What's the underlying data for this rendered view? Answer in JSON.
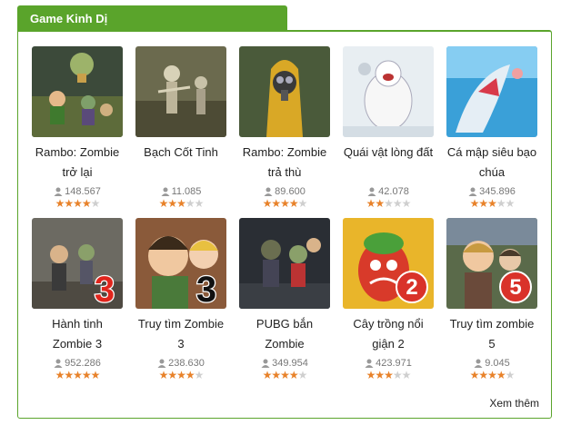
{
  "section": {
    "title": "Game Kinh Dị",
    "more_label": "Xem thêm"
  },
  "colors": {
    "accent": "#5aa42b",
    "star_on": "#e8822a",
    "star_off": "#cfcfcf"
  },
  "games": [
    {
      "title_l1": "Rambo: Zombie",
      "title_l2": "trở lại",
      "plays": "148.567",
      "rating": 4,
      "thumb": "rambo-zombie-return",
      "badge": ""
    },
    {
      "title_l1": "Bạch Cốt Tinh",
      "title_l2": "",
      "plays": "11.085",
      "rating": 3,
      "thumb": "skeleton-warriors",
      "badge": ""
    },
    {
      "title_l1": "Rambo: Zombie",
      "title_l2": "trả thù",
      "plays": "89.600",
      "rating": 4,
      "thumb": "gas-mask-soldier",
      "badge": ""
    },
    {
      "title_l1": "Quái vật lòng đất",
      "title_l2": "",
      "plays": "42.078",
      "rating": 2,
      "thumb": "yeti-monster",
      "badge": ""
    },
    {
      "title_l1": "Cá mập siêu bạo",
      "title_l2": "chúa",
      "plays": "345.896",
      "rating": 3,
      "thumb": "shark-attack",
      "badge": ""
    },
    {
      "title_l1": "Hành tinh",
      "title_l2": "Zombie 3",
      "plays": "952.286",
      "rating": 5,
      "thumb": "zombie-planet-3",
      "badge": "3"
    },
    {
      "title_l1": "Truy tìm Zombie",
      "title_l2": "3",
      "plays": "238.630",
      "rating": 4,
      "thumb": "zombie-hunt-3",
      "badge": "3"
    },
    {
      "title_l1": "PUBG bắn",
      "title_l2": "Zombie",
      "plays": "349.954",
      "rating": 4,
      "thumb": "pubg-zombie",
      "badge": ""
    },
    {
      "title_l1": "Cây trồng nổi",
      "title_l2": "giận 2",
      "plays": "423.971",
      "rating": 3,
      "thumb": "angry-plants-2",
      "badge": "2"
    },
    {
      "title_l1": "Truy tìm zombie",
      "title_l2": "5",
      "plays": "9.045",
      "rating": 4,
      "thumb": "zombie-hunt-5",
      "badge": "5"
    }
  ]
}
